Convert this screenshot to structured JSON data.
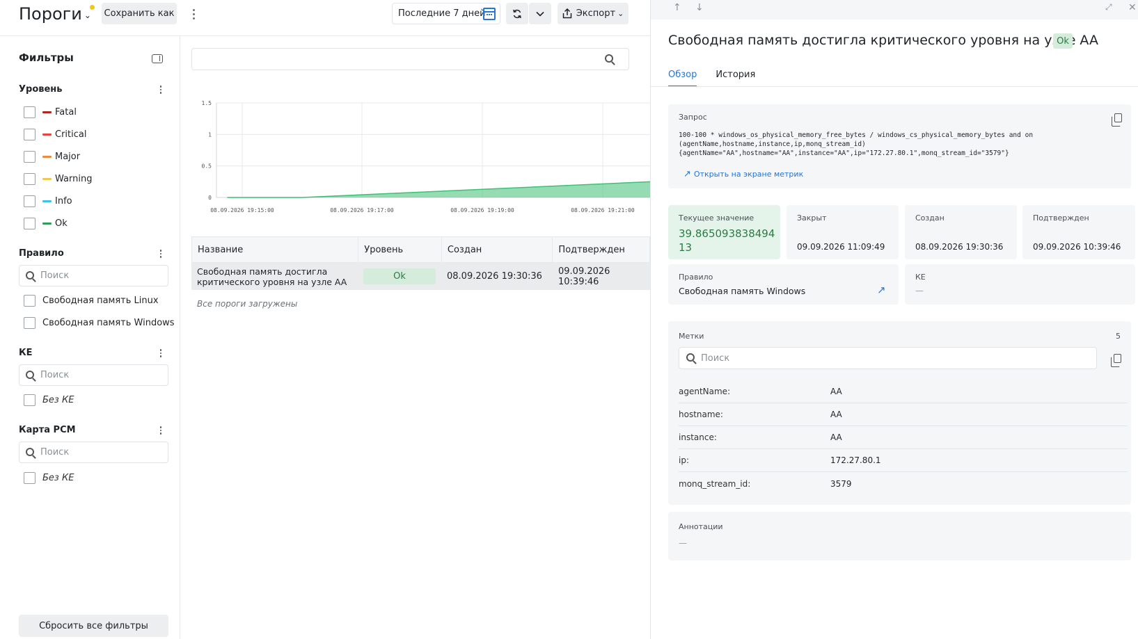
{
  "header": {
    "title": "Пороги",
    "save_as": "Сохранить как",
    "period": "Последние 7 дней",
    "export": "Экспорт"
  },
  "sidebar": {
    "title": "Фильтры",
    "level": {
      "title": "Уровень",
      "items": [
        {
          "label": "Fatal",
          "color": "#b3261e"
        },
        {
          "label": "Critical",
          "color": "#e8453c"
        },
        {
          "label": "Major",
          "color": "#f08a3c"
        },
        {
          "label": "Warning",
          "color": "#f2c94c"
        },
        {
          "label": "Info",
          "color": "#3cc3e8"
        },
        {
          "label": "Ok",
          "color": "#2f9e5a"
        }
      ]
    },
    "rule": {
      "title": "Правило",
      "search_placeholder": "Поиск",
      "items": [
        "Свободная память Linux",
        "Свободная память Windows"
      ]
    },
    "ke": {
      "title": "КЕ",
      "search_placeholder": "Поиск",
      "items": [
        "Без КЕ"
      ]
    },
    "rsm": {
      "title": "Карта РСМ",
      "search_placeholder": "Поиск",
      "items": [
        "Без КЕ"
      ]
    },
    "reset": "Сбросить все фильтры"
  },
  "chart_data": {
    "type": "area",
    "y_ticks": [
      "1.5",
      "1",
      "0.5",
      "0"
    ],
    "x_ticks": [
      "08.09.2026 19:15:00",
      "08.09.2026 19:17:00",
      "08.09.2026 19:19:00",
      "08.09.2026 19:21:00"
    ],
    "ylim": [
      0,
      1.5
    ],
    "series": [
      {
        "color": "#3fbf74",
        "x": [
          "08.09.2026 19:14:45",
          "08.09.2026 19:16:00",
          "08.09.2026 19:22:00"
        ],
        "values": [
          0,
          0,
          0.25
        ]
      }
    ]
  },
  "table": {
    "columns": [
      "Название",
      "Уровень",
      "Создан",
      "Подтвержден"
    ],
    "rows": [
      {
        "name": "Свободная память достигла критического уровня на узле AA",
        "level": "Ok",
        "created": "08.09.2026 19:30:36",
        "confirmed": "09.09.2026 10:39:46"
      }
    ],
    "footer": "Все пороги загружены"
  },
  "details": {
    "title": "Свободная память достигла критического уровня на узле AA",
    "status": "Ok",
    "tabs": [
      "Обзор",
      "История"
    ],
    "query_label": "Запрос",
    "query_lines": [
      "100-100 * windows_os_physical_memory_free_bytes / windows_cs_physical_memory_bytes and on",
      "(agentName,hostname,instance,ip,monq_stream_id)",
      "{agentName=\"AA\",hostname=\"AA\",instance=\"AA\",ip=\"172.27.80.1\",monq_stream_id=\"3579\"}"
    ],
    "open_metrics": "Открыть на экране метрик",
    "current_label": "Текущее значение",
    "current_value_1": "39.865093838494",
    "current_value_2": "13",
    "closed_label": "Закрыт",
    "closed_value": "09.09.2026 11:09:49",
    "created_label": "Создан",
    "created_value": "08.09.2026 19:30:36",
    "confirmed_label": "Подтвержден",
    "confirmed_value": "09.09.2026 10:39:46",
    "rule_label": "Правило",
    "rule_value": "Свободная память Windows",
    "ke_label": "КЕ",
    "ke_value": "—",
    "labels_title": "Метки",
    "labels_count": "5",
    "labels_search": "Поиск",
    "labels": [
      {
        "k": "agentName:",
        "v": "AA"
      },
      {
        "k": "hostname:",
        "v": "AA"
      },
      {
        "k": "instance:",
        "v": "AA"
      },
      {
        "k": "ip:",
        "v": "172.27.80.1"
      },
      {
        "k": "monq_stream_id:",
        "v": "3579"
      }
    ],
    "annotations_label": "Аннотации",
    "annotations_value": "—"
  }
}
